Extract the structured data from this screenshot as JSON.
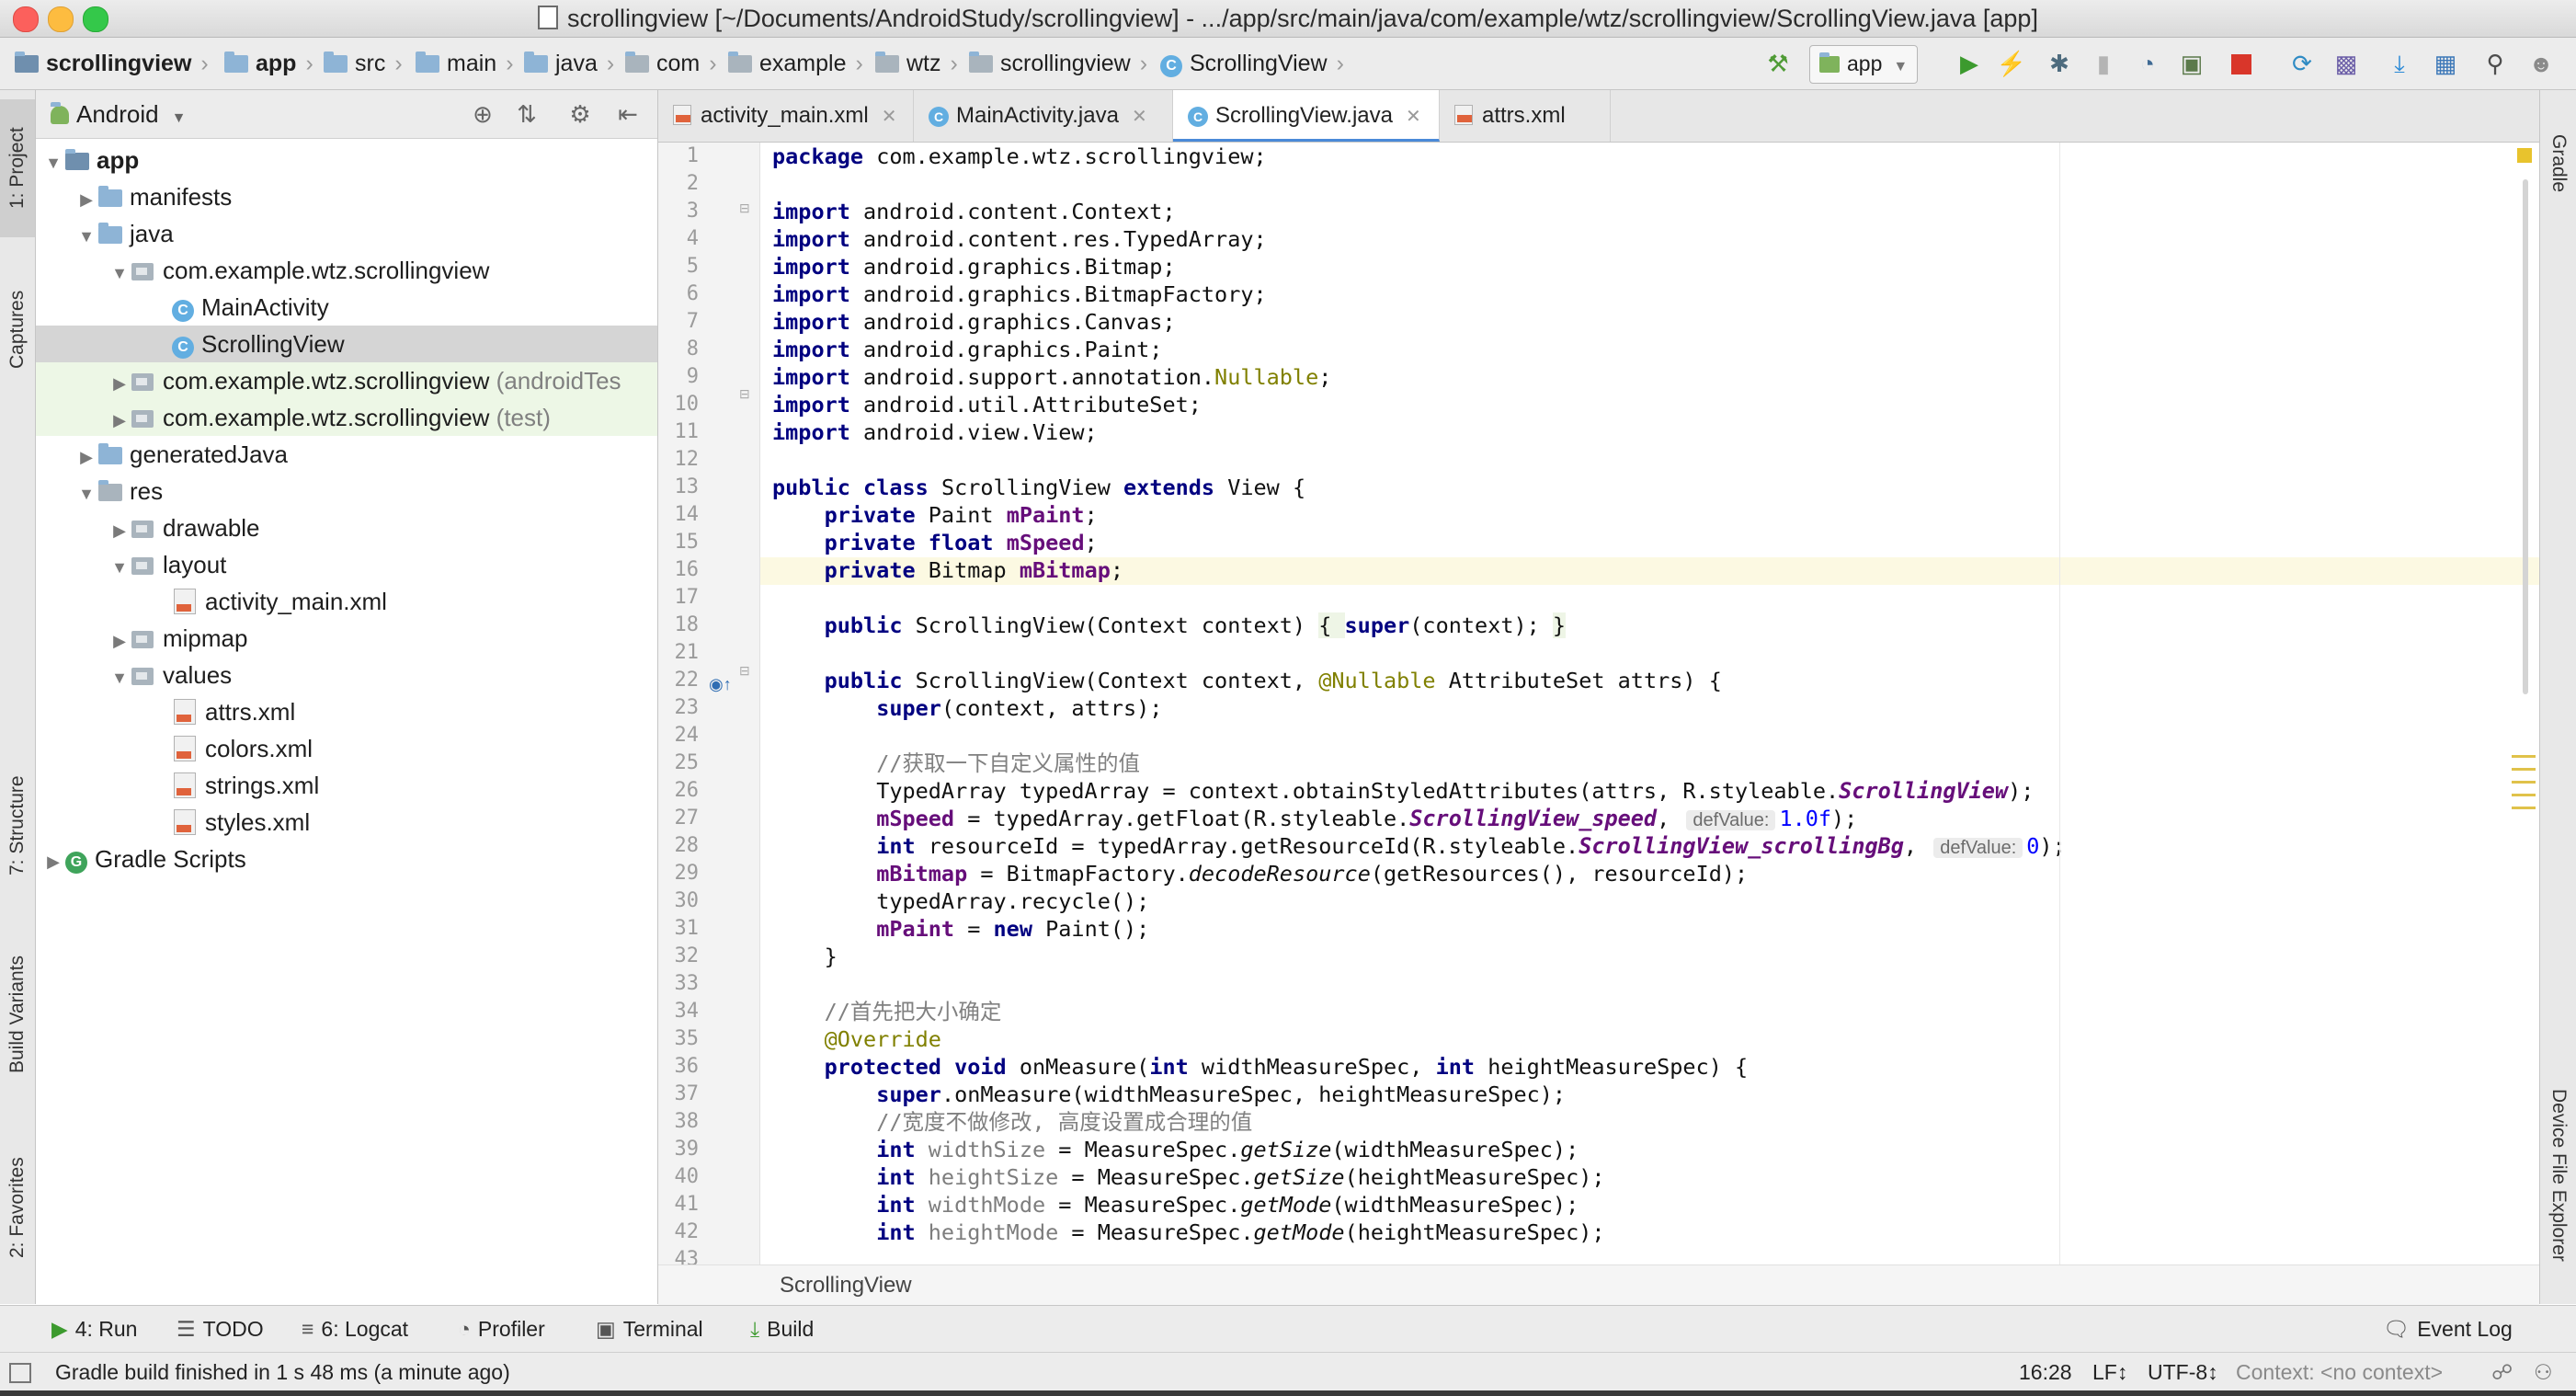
{
  "window": {
    "title": "scrollingview [~/Documents/AndroidStudy/scrollingview] - .../app/src/main/java/com/example/wtz/scrollingview/ScrollingView.java [app]"
  },
  "navbar": {
    "crumbs": [
      "scrollingview",
      "app",
      "src",
      "main",
      "java",
      "com",
      "example",
      "wtz",
      "scrollingview",
      "ScrollingView"
    ],
    "run_config": "app"
  },
  "left_strip": {
    "tabs": [
      "1: Project",
      "Captures",
      "7: Structure",
      "Build Variants",
      "2: Favorites"
    ]
  },
  "right_strip": {
    "tabs": [
      "Gradle",
      "Device File Explorer"
    ]
  },
  "project": {
    "view_mode": "Android",
    "tree": [
      {
        "label": "app",
        "suffix": ""
      },
      {
        "label": "manifests",
        "suffix": ""
      },
      {
        "label": "java",
        "suffix": ""
      },
      {
        "label": "com.example.wtz.scrollingview",
        "suffix": ""
      },
      {
        "label": "MainActivity",
        "suffix": ""
      },
      {
        "label": "ScrollingView",
        "suffix": ""
      },
      {
        "label": "com.example.wtz.scrollingview",
        "suffix": " (androidTes"
      },
      {
        "label": "com.example.wtz.scrollingview",
        "suffix": " (test)"
      },
      {
        "label": "generatedJava",
        "suffix": ""
      },
      {
        "label": "res",
        "suffix": ""
      },
      {
        "label": "drawable",
        "suffix": ""
      },
      {
        "label": "layout",
        "suffix": ""
      },
      {
        "label": "activity_main.xml",
        "suffix": ""
      },
      {
        "label": "mipmap",
        "suffix": ""
      },
      {
        "label": "values",
        "suffix": ""
      },
      {
        "label": "attrs.xml",
        "suffix": ""
      },
      {
        "label": "colors.xml",
        "suffix": ""
      },
      {
        "label": "strings.xml",
        "suffix": ""
      },
      {
        "label": "styles.xml",
        "suffix": ""
      },
      {
        "label": "Gradle Scripts",
        "suffix": ""
      }
    ]
  },
  "editor": {
    "tabs": [
      "activity_main.xml",
      "MainActivity.java",
      "ScrollingView.java",
      "attrs.xml"
    ],
    "active_tab": "ScrollingView.java",
    "line_numbers": [
      "1",
      "2",
      "3",
      "4",
      "5",
      "6",
      "7",
      "8",
      "9",
      "10",
      "11",
      "12",
      "13",
      "14",
      "15",
      "16",
      "17",
      "18",
      "21",
      "22",
      "23",
      "24",
      "25",
      "26",
      "27",
      "28",
      "29",
      "30",
      "31",
      "32",
      "33",
      "34",
      "35",
      "36",
      "37",
      "38",
      "39",
      "40",
      "41",
      "42",
      "43"
    ],
    "code": {
      "l1_kw": "package",
      "l1_rest": " com.example.wtz.scrollingview;",
      "import_kw": "import",
      "imports": [
        " android.content.Context;",
        " android.content.res.TypedArray;",
        " android.graphics.Bitmap;",
        " android.graphics.BitmapFactory;",
        " android.graphics.Canvas;",
        " android.graphics.Paint;",
        " android.support.annotation.",
        " android.util.AttributeSet;",
        " android.view.View;"
      ],
      "nullable_ann": "Nullable",
      "semicolon": ";",
      "public": "public",
      "class": "class",
      "extends": "extends",
      "private": "private",
      "float": "float",
      "int": "int",
      "new": "new",
      "super": "super",
      "protected": "protected",
      "void": "void",
      "class_name": " ScrollingView ",
      "view_tail": " View {",
      "paint_type": " Paint ",
      "mPaint": "mPaint",
      "mSpeed": "mSpeed",
      "bitmap_type": " Bitmap ",
      "mBitmap": "mBitmap",
      "ctor1_a": " ScrollingView(Context context) ",
      "ctor1_b": "{ ",
      "ctor1_c": "(context); ",
      "ctor1_d": "}",
      "ctor2_a": " ScrollingView(Context context, ",
      "at_nullable": "@Nullable",
      "ctor2_b": " AttributeSet attrs) {",
      "super_args": "(context, attrs);",
      "comment1": "//获取一下自定义属性的值",
      "l26_a": "TypedArray typedArray = context.obtainStyledAttributes(attrs, R.styleable.",
      "l26_b": "ScrollingView",
      "l26_c": ");",
      "l27_a": " = typedArray.getFloat(R.styleable.",
      "l27_b": "ScrollingView_speed",
      "l27_c": ",",
      "def_value": "defValue:",
      "l27_num": "1.0f",
      "l27_end": ");",
      "l28_a": " resourceId = typedArray.getResourceId(R.styleable.",
      "l28_b": "ScrollingView_scrollingBg",
      "l28_c": ",",
      "l28_num": "0",
      "l28_end": ");",
      "l29_a": " = BitmapFactory.",
      "l29_b": "decodeResource",
      "l29_c": "(getResources(), resourceId);",
      "l30": "typedArray.recycle();",
      "l31_a": " = ",
      "l31_b": " Paint();",
      "close_brace": "}",
      "comment2": "//首先把大小确定",
      "override": "@Override",
      "l36_a": " onMeasure(",
      "l36_b": " widthMeasureSpec, ",
      "l36_c": " heightMeasureSpec) {",
      "l37": ".onMeasure(widthMeasureSpec, heightMeasureSpec);",
      "comment3": "//宽度不做修改, 高度设置成合理的值",
      "widthSize": " widthSize",
      "heightSize": " heightSize",
      "widthMode": " widthMode",
      "heightMode": " heightMode",
      "eq_spec": " = MeasureSpec.",
      "getSize": "getSize",
      "getMode": "getMode",
      "arg_w": "(widthMeasureSpec);",
      "arg_h": "(heightMeasureSpec);"
    },
    "breadcrumb": "ScrollingView"
  },
  "bottom_tools": [
    "4: Run",
    "TODO",
    "6: Logcat",
    "Profiler",
    "Terminal",
    "Build",
    "Event Log"
  ],
  "status": {
    "message": "Gradle build finished in 1 s 48 ms (a minute ago)",
    "position": "16:28",
    "line_sep": "LF↕",
    "encoding": "UTF-8↕",
    "context": "Context: <no context>"
  },
  "colors": {
    "keyword": "#000080",
    "field": "#660e7a",
    "annotation": "#808000",
    "comment": "#808080",
    "number": "#0000ff",
    "run_green": "#3c9a2e",
    "stop_red": "#d9362a"
  }
}
